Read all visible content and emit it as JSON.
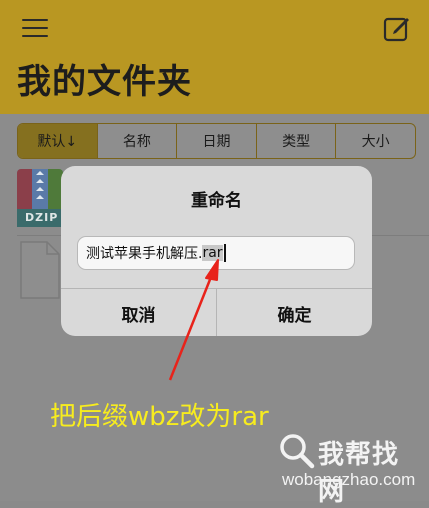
{
  "header": {
    "title": "我的文件夹"
  },
  "sort_tabs": [
    {
      "label": "默认↓",
      "active": true
    },
    {
      "label": "名称",
      "active": false
    },
    {
      "label": "日期",
      "active": false
    },
    {
      "label": "类型",
      "active": false
    },
    {
      "label": "大小",
      "active": false
    }
  ],
  "files": [
    {
      "thumb_label": "DZIP"
    }
  ],
  "dialog": {
    "title": "重命名",
    "input_value_before": "测试苹果手机解压.",
    "input_value_selected": "rar",
    "cancel_label": "取消",
    "confirm_label": "确定"
  },
  "annotation": {
    "text": "把后缀wbz改为rar"
  },
  "watermark": {
    "title": "我帮找网",
    "url": "wobangzhao.com"
  },
  "colors": {
    "accent": "#b99722",
    "annotation": "#f7ec1e",
    "arrow": "#e8231b"
  },
  "icons": {
    "menu": "hamburger-menu-icon",
    "edit": "compose-icon",
    "file": "document-icon",
    "search": "magnifier-icon"
  }
}
